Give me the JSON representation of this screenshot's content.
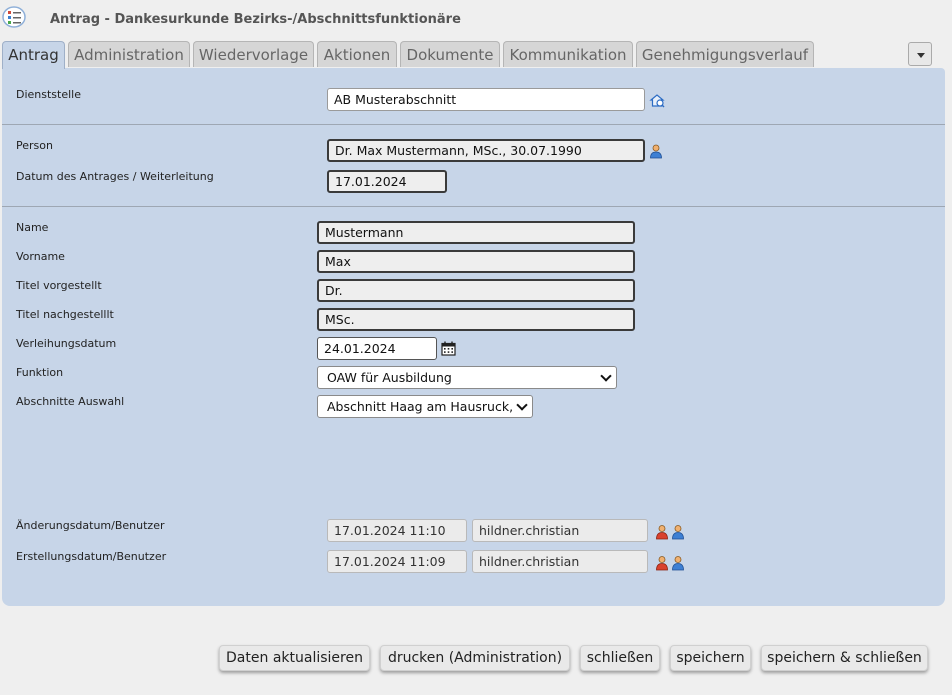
{
  "window": {
    "title": "Antrag - Dankesurkunde Bezirks-/Abschnittsfunktionäre"
  },
  "tabs": [
    "Antrag",
    "Administration",
    "Wiedervorlage",
    "Aktionen",
    "Dokumente",
    "Kommunikation",
    "Genehmigungsverlauf"
  ],
  "form": {
    "dienststelle": {
      "label": "Dienststelle",
      "value": "AB Musterabschnitt"
    },
    "person": {
      "label": "Person",
      "value": "Dr. Max Mustermann, MSc., 30.07.1990"
    },
    "datum_antrag": {
      "label": "Datum des Antrages / Weiterleitung",
      "value": "17.01.2024"
    },
    "name": {
      "label": "Name",
      "value": "Mustermann"
    },
    "vorname": {
      "label": "Vorname",
      "value": "Max"
    },
    "titel_vor": {
      "label": "Titel vorgestellt",
      "value": "Dr."
    },
    "titel_nach": {
      "label": "Titel nachgestelllt",
      "value": "MSc."
    },
    "verleihungsdatum": {
      "label": "Verleihungsdatum",
      "value": "24.01.2024"
    },
    "funktion": {
      "label": "Funktion",
      "value": "OAW für Ausbildung"
    },
    "abschnitte": {
      "label": "Abschnitte Auswahl",
      "value": "Abschnitt Haag am Hausruck,"
    },
    "aenderung": {
      "label": "Änderungsdatum/Benutzer",
      "date": "17.01.2024 11:10",
      "user": "hildner.christian"
    },
    "erstellung": {
      "label": "Erstellungsdatum/Benutzer",
      "date": "17.01.2024 11:09",
      "user": "hildner.christian"
    }
  },
  "buttons": {
    "refresh": "Daten aktualisieren",
    "print": "drucken (Administration)",
    "close": "schließen",
    "save": "speichern",
    "save_close": "speichern & schließen"
  },
  "colors": {
    "panel": "#c7d5e8",
    "background": "#efefef",
    "tab_inactive": "#d6d6d6"
  }
}
